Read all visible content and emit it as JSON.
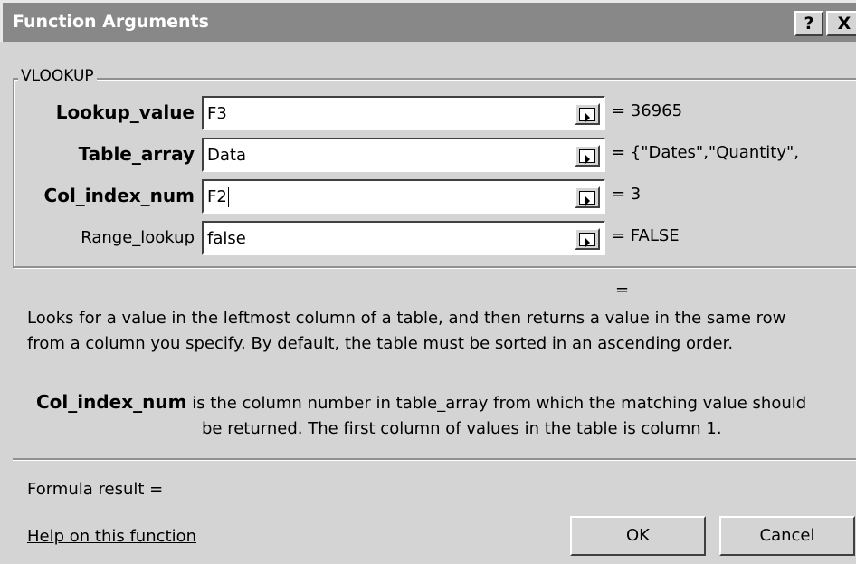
{
  "window": {
    "title": "Function Arguments",
    "help_label": "?",
    "close_label": "X"
  },
  "group": {
    "function_name": "VLOOKUP"
  },
  "arguments": [
    {
      "label": "Lookup_value",
      "value": "F3",
      "result": "= 36965"
    },
    {
      "label": "Table_array",
      "value": "Data",
      "result": "= {\"Dates\",\"Quantity\","
    },
    {
      "label": "Col_index_num",
      "value": "F2",
      "result": "= 3"
    },
    {
      "label": "Range_lookup",
      "value": "false",
      "result": "= FALSE"
    }
  ],
  "function_result": "=",
  "description": {
    "line1": "Looks for a value in the leftmost column of a table, and then returns a value in the same row",
    "line2": "from a column you specify. By default, the table must be sorted in an ascending order."
  },
  "argument_help": {
    "name": "Col_index_num",
    "text1": " is the column number in table_array from which the matching value should",
    "text2": "be returned. The first column of values in the table is column 1."
  },
  "formula_result": "Formula result =",
  "help_link": "Help on this function",
  "buttons": {
    "ok": "OK",
    "cancel": "Cancel"
  }
}
